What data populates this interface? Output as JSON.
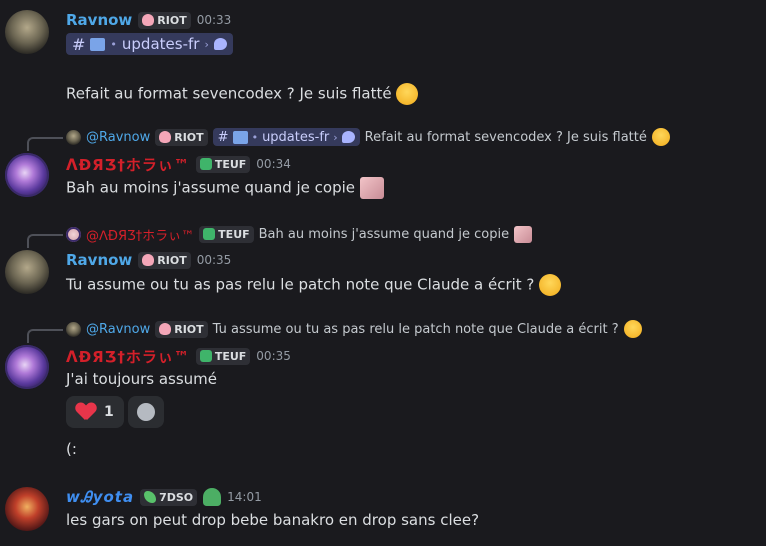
{
  "users": {
    "ravnow": {
      "name": "Ravnow",
      "tag": "RIOT"
    },
    "adr": {
      "name": "ᐱÐЯƷ†ホラぃ™",
      "tag": "TEUF"
    },
    "w": {
      "name": "wᎯyota",
      "tag": "7DSO"
    }
  },
  "channel": {
    "name": "updates-fr"
  },
  "messages": [
    {
      "time": "00:33",
      "text": "Refait au format sevencodex ? Je suis flatté"
    },
    {
      "reply_user": "@Ravnow",
      "reply_text": "Refait au format sevencodex ? Je suis flatté",
      "time": "00:34",
      "text": "Bah au moins j'assume quand je copie"
    },
    {
      "reply_user": "@ᐱÐЯƷ†ホラぃ™",
      "reply_text": "Bah au moins j'assume quand je copie",
      "time": "00:35",
      "text": "Tu assume ou tu as pas relu le patch note que Claude a écrit ?"
    },
    {
      "reply_user": "@Ravnow",
      "reply_text": "Tu assume ou tu as pas relu le patch note que Claude a écrit ?",
      "time": "00:35",
      "text": "J'ai toujours assumé",
      "reaction_count": "1",
      "followup": "(:"
    },
    {
      "time": "14:01",
      "text": "les gars on peut drop bebe banakro en drop sans clee?"
    }
  ]
}
